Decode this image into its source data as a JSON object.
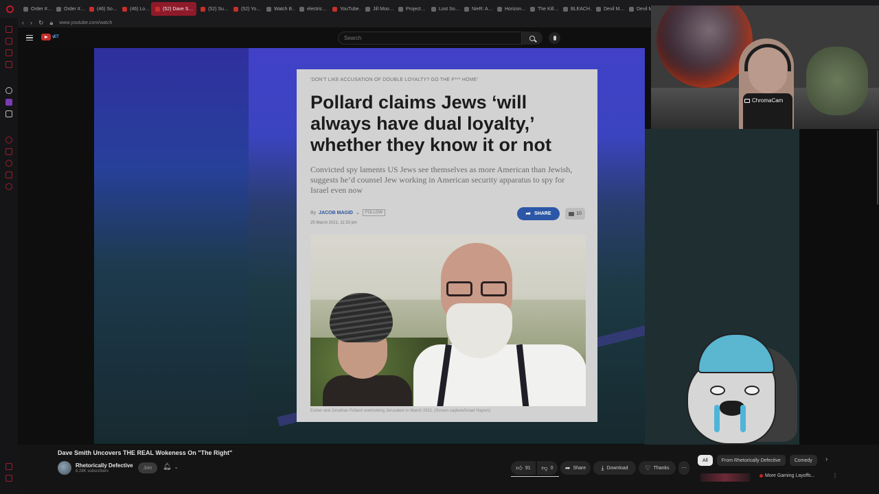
{
  "browser": {
    "tabs": [
      {
        "label": "Order #…",
        "fav": "plain"
      },
      {
        "label": "Order #…",
        "fav": "plain"
      },
      {
        "label": "(46) So…",
        "fav": "red"
      },
      {
        "label": "(46) Lo…",
        "fav": "red"
      },
      {
        "label": "(52) Dave S…",
        "fav": "red",
        "active": true
      },
      {
        "label": "(52) Su…",
        "fav": "red"
      },
      {
        "label": "(52) Yo…",
        "fav": "red"
      },
      {
        "label": "Watch B…",
        "fav": "plain"
      },
      {
        "label": "electric…",
        "fav": "plain"
      },
      {
        "label": "YouTube…",
        "fav": "red"
      },
      {
        "label": "Jill Moo…",
        "fav": "plain"
      },
      {
        "label": "Project…",
        "fav": "plain"
      },
      {
        "label": "Lost So…",
        "fav": "plain"
      },
      {
        "label": "NieR: A…",
        "fav": "plain"
      },
      {
        "label": "Horizon…",
        "fav": "plain"
      },
      {
        "label": "The Kill…",
        "fav": "plain"
      },
      {
        "label": "BLEACH…",
        "fav": "plain"
      },
      {
        "label": "Devil M…",
        "fav": "plain"
      },
      {
        "label": "Devil M…",
        "fav": "plain"
      }
    ],
    "url": "www.youtube.com/watch"
  },
  "youtube": {
    "search_placeholder": "Search"
  },
  "article": {
    "kicker": "'DON'T LIKE ACCUSATION OF DOUBLE LOYALTY? GO THE F*** HOME'",
    "headline": "Pollard claims Jews ‘will always have dual loyalty,’ whether they know it or not",
    "subhead": "Convicted spy laments US Jews see themselves as more American than Jewish, suggests he’d counsel Jew working in American security apparatus to spy for Israel even now",
    "by_prefix": "By",
    "author": "JACOB MAGID",
    "follow_label": "FOLLOW",
    "date": "25 March 2021, 11:33 pm",
    "share_label": "SHARE",
    "comments_count": "10",
    "photo_caption": "Esther and Jonathan Pollard overlooking Jerusalem in March 2021. (Screen capture/Israel Hayom)"
  },
  "webcam": {
    "label": "ChromaCam"
  },
  "watch": {
    "title": "Dave Smith Uncovers THE REAL Wokeness On \"The Right\"",
    "channel": "Rhetorically Defective",
    "subscribers": "8.28K subscribers",
    "join_label": "Join",
    "likes": "91",
    "dislikes": "0",
    "share_label": "Share",
    "download_label": "Download",
    "thanks_label": "Thanks",
    "chips": [
      "All",
      "From Rhetorically Defective",
      "Comedy"
    ],
    "rec_title": "More Gaming Layoffs..."
  }
}
